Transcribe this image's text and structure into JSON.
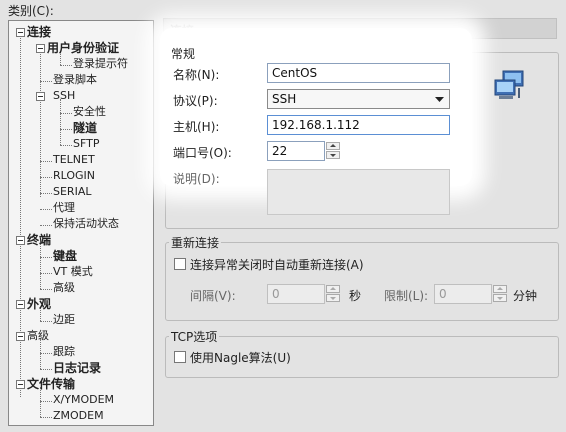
{
  "category_label": "类别(C):",
  "tree": {
    "items": [
      {
        "label": "连接"
      },
      {
        "label": "用户身份验证"
      },
      {
        "label": "登录提示符"
      },
      {
        "label": "登录脚本"
      },
      {
        "label": "SSH"
      },
      {
        "label": "安全性"
      },
      {
        "label": "隧道"
      },
      {
        "label": "SFTP"
      },
      {
        "label": "TELNET"
      },
      {
        "label": "RLOGIN"
      },
      {
        "label": "SERIAL"
      },
      {
        "label": "代理"
      },
      {
        "label": "保持活动状态"
      },
      {
        "label": "终端"
      },
      {
        "label": "键盘"
      },
      {
        "label": "VT 模式"
      },
      {
        "label": "高级"
      },
      {
        "label": "外观"
      },
      {
        "label": "边距"
      },
      {
        "label": "高级"
      },
      {
        "label": "跟踪"
      },
      {
        "label": "日志记录"
      },
      {
        "label": "文件传输"
      },
      {
        "label": "X/YMODEM"
      },
      {
        "label": "ZMODEM"
      }
    ]
  },
  "panel": {
    "header": "连接",
    "general": {
      "title": "常规",
      "name_label": "名称(N):",
      "name_value": "CentOS",
      "protocol_label": "协议(P):",
      "protocol_value": "SSH",
      "host_label": "主机(H):",
      "host_value": "192.168.1.112",
      "port_label": "端口号(O):",
      "port_value": "22",
      "desc_label": "说明(D):"
    },
    "reconnect": {
      "title": "重新连接",
      "checkbox_label": "连接异常关闭时自动重新连接(A)",
      "interval_label": "间隔(V):",
      "interval_value": "0",
      "interval_unit": "秒",
      "limit_label": "限制(L):",
      "limit_value": "0",
      "limit_unit": "分钟"
    },
    "tcp": {
      "title": "TCP选项",
      "nagle_label": "使用Nagle算法(U)"
    }
  },
  "icons": {
    "network": "network-computers-icon"
  }
}
